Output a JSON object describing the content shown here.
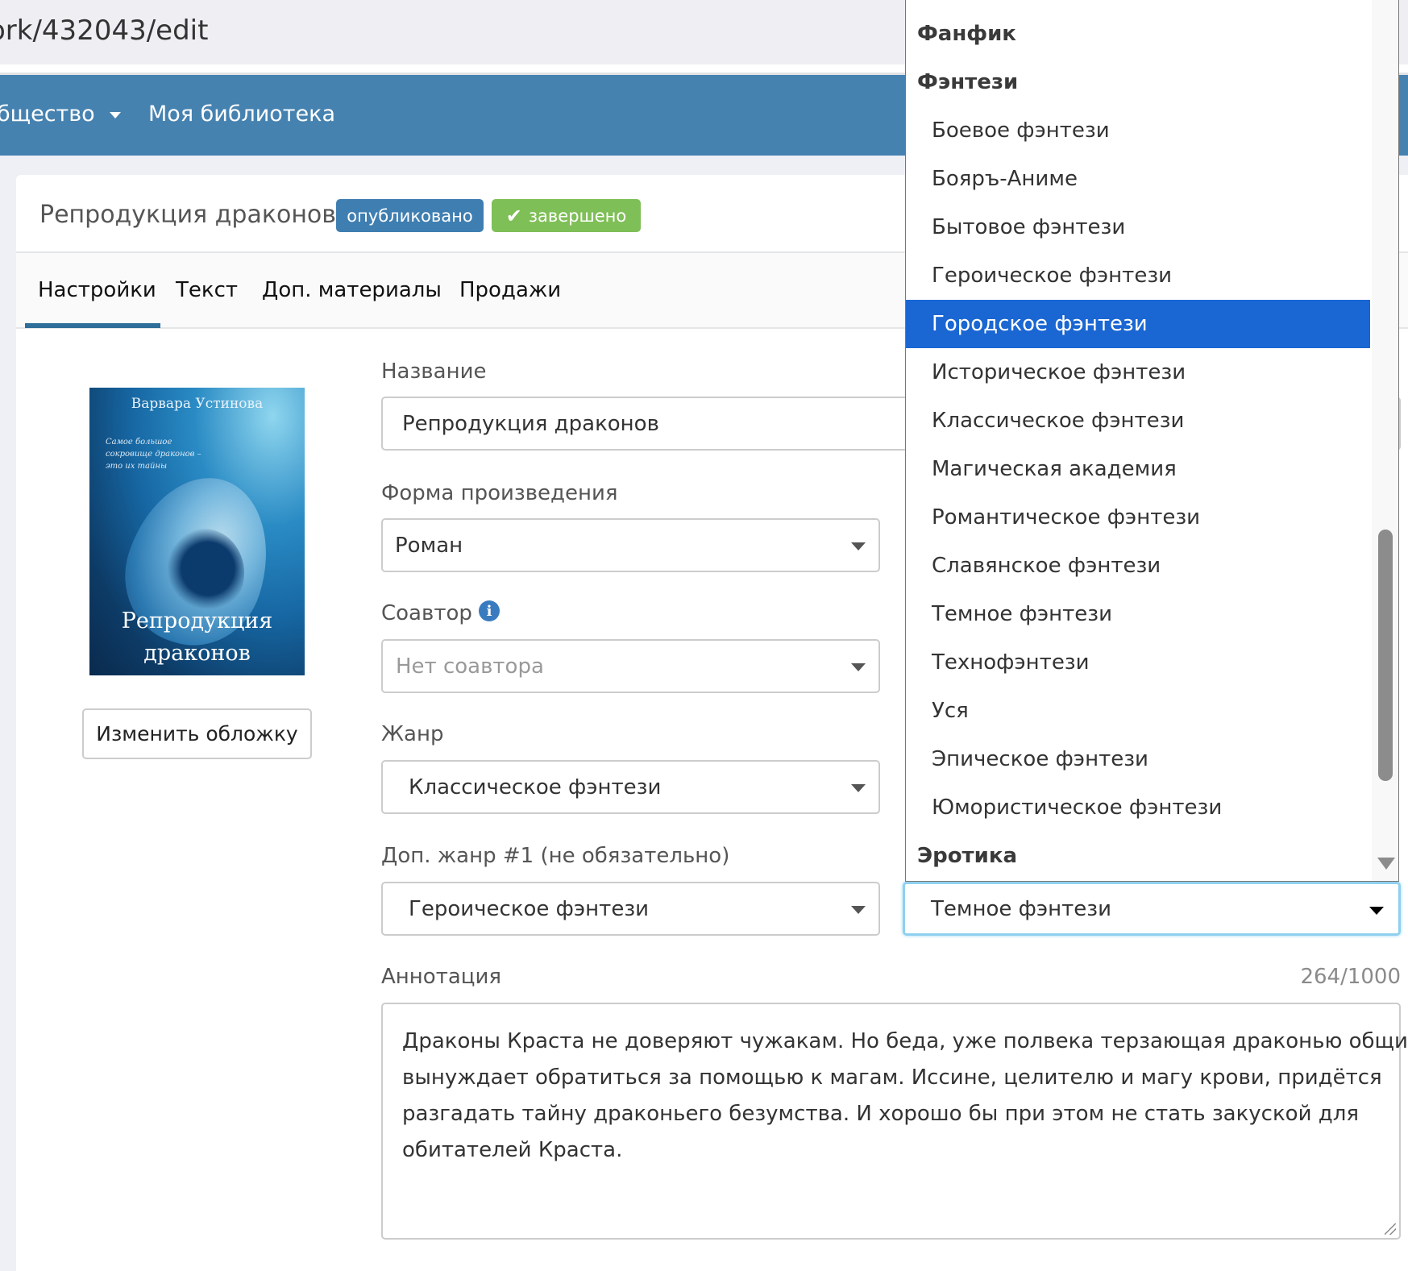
{
  "browser": {
    "url": "ork/432043/edit"
  },
  "nav": {
    "items": [
      {
        "label": "бщество",
        "has_caret": true
      },
      {
        "label": "Моя библиотека"
      }
    ]
  },
  "work": {
    "title": "Репродукция драконов",
    "badges": {
      "published": "опубликовано",
      "completed": "завершено"
    },
    "colors": {
      "published": "#3f7eb1",
      "completed": "#7fbf57",
      "nav": "#4682b0",
      "highlight": "#1a66d2"
    }
  },
  "tabs": [
    {
      "label": "Настройки",
      "active": true
    },
    {
      "label": "Текст"
    },
    {
      "label": "Доп. материалы"
    },
    {
      "label": "Продажи"
    }
  ],
  "cover": {
    "author": "Варвара Устинова",
    "tagline": "Самое большое сокровище драконов – это их тайны",
    "title_line1": "Репродукция",
    "title_line2": "драконов",
    "change_button": "Изменить обложку"
  },
  "form": {
    "name_label": "Название",
    "name_value": "Репродукция драконов",
    "form_label": "Форма произведения",
    "form_value": "Роман",
    "coauthor_label": "Соавтор",
    "coauthor_placeholder": "Нет соавтора",
    "genre_label": "Жанр",
    "genre_value": "Классическое фэнтези",
    "extra_genre1_label": "Доп. жанр #1 (не обязательно)",
    "extra_genre1_value": "Героическое фэнтези",
    "extra_genre2_value": "Темное фэнтези",
    "annotation_label": "Аннотация",
    "annotation_counter": "264/1000",
    "annotation_lines": [
      "Драконы Краста не доверяют чужакам. Но беда, уже полвека терзающая драконью общину,",
      "вынуждает обратиться за помощью к магам. Иссине, целителю и магу крови, придётся",
      "разгадать тайну драконьего безумства. И хорошо бы при этом не стать закуской для",
      "обитателей Краста."
    ]
  },
  "dropdown": {
    "options": [
      {
        "label": "Фанфик",
        "group": true
      },
      {
        "label": "Фэнтези",
        "group": true
      },
      {
        "label": "Боевое фэнтези"
      },
      {
        "label": "Бояръ-Аниме"
      },
      {
        "label": "Бытовое фэнтези"
      },
      {
        "label": "Героическое фэнтези"
      },
      {
        "label": "Городское фэнтези",
        "highlighted": true
      },
      {
        "label": "Историческое фэнтези"
      },
      {
        "label": "Классическое фэнтези"
      },
      {
        "label": "Магическая академия"
      },
      {
        "label": "Романтическое фэнтези"
      },
      {
        "label": "Славянское фэнтези"
      },
      {
        "label": "Темное фэнтези"
      },
      {
        "label": "Технофэнтези"
      },
      {
        "label": "Уся"
      },
      {
        "label": "Эпическое фэнтези"
      },
      {
        "label": "Юмористическое фэнтези"
      },
      {
        "label": "Эротика",
        "group": true
      }
    ],
    "scroll_fraction": 0.55
  }
}
